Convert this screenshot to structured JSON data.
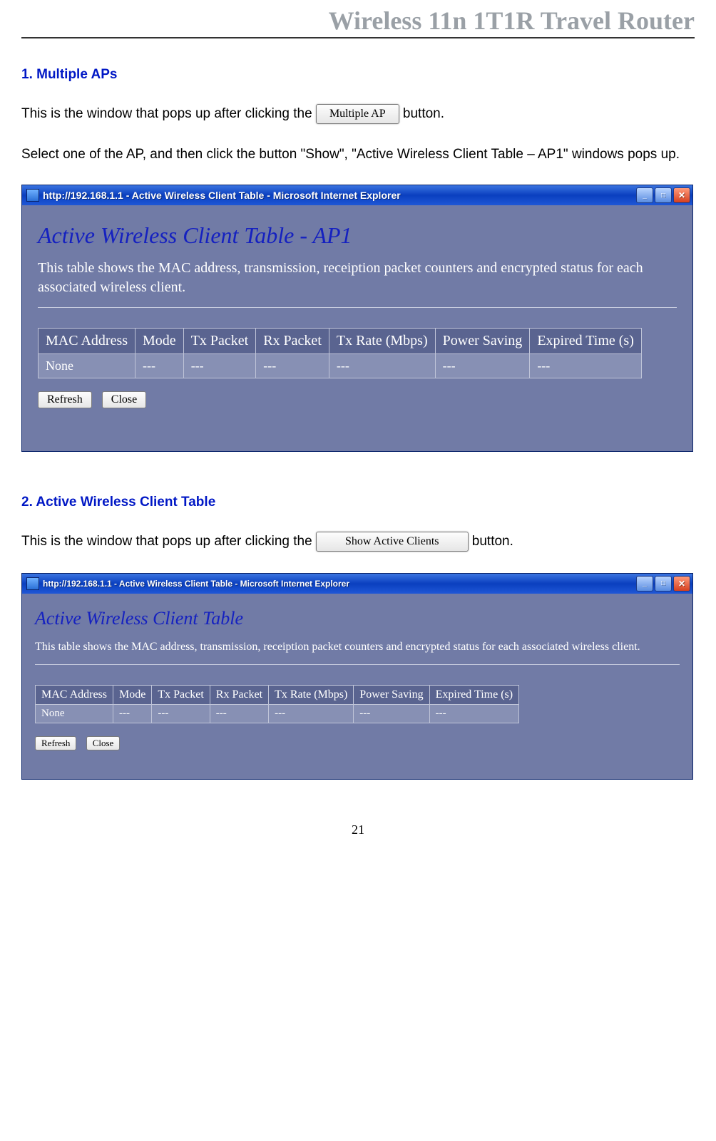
{
  "doc_header": "Wireless 11n 1T1R Travel Router",
  "page_number": "21",
  "section1": {
    "heading": "1. Multiple APs",
    "intro_pre": "This is the window that pops up after clicking the ",
    "button_label": "Multiple AP",
    "intro_post": " button.",
    "below": "Select one of the AP, and then click the button \"Show\", \"Active Wireless Client Table – AP1\" windows pops up."
  },
  "window1": {
    "title": "http://192.168.1.1 - Active Wireless Client Table - Microsoft Internet Explorer",
    "panel_title": "Active Wireless Client Table - AP1",
    "panel_desc": "This table shows the MAC address, transmission, receiption packet counters and encrypted status for each associated wireless client.",
    "columns": [
      "MAC Address",
      "Mode",
      "Tx Packet",
      "Rx Packet",
      "Tx Rate (Mbps)",
      "Power Saving",
      "Expired Time (s)"
    ],
    "row": [
      "None",
      "---",
      "---",
      "---",
      "---",
      "---",
      "---"
    ],
    "refresh": "Refresh",
    "close": "Close"
  },
  "section2": {
    "heading": "2. Active Wireless Client Table",
    "intro_pre": "This is the window that pops up after clicking the ",
    "button_label": "Show Active Clients",
    "intro_post": " button."
  },
  "window2": {
    "title": "http://192.168.1.1 - Active Wireless Client Table - Microsoft Internet Explorer",
    "panel_title": "Active Wireless Client Table",
    "panel_desc": "This table shows the MAC address, transmission, receiption packet counters and encrypted status for each associated wireless client.",
    "columns": [
      "MAC Address",
      "Mode",
      "Tx Packet",
      "Rx Packet",
      "Tx Rate (Mbps)",
      "Power Saving",
      "Expired Time (s)"
    ],
    "row": [
      "None",
      "---",
      "---",
      "---",
      "---",
      "---",
      "---"
    ],
    "refresh": "Refresh",
    "close": "Close"
  }
}
